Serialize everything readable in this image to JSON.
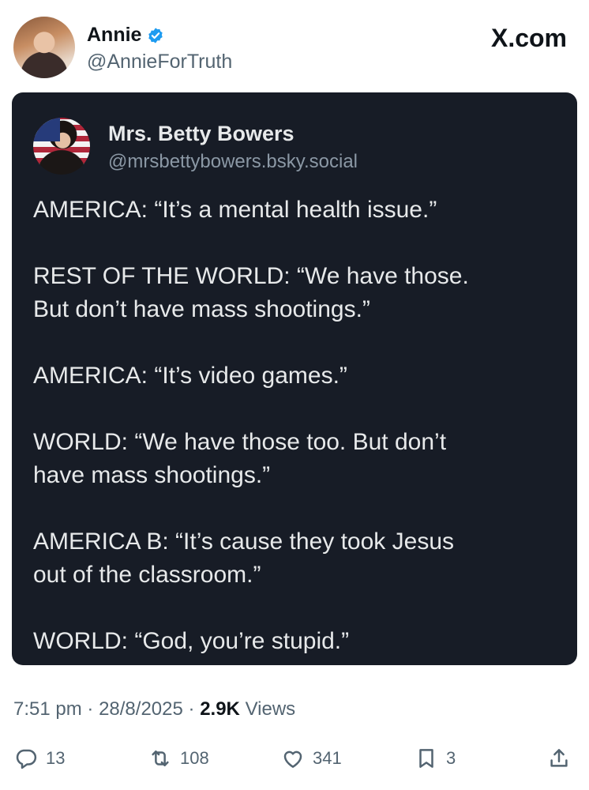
{
  "author": {
    "name": "Annie",
    "handle": "@AnnieForTruth",
    "verified_color": "#1d9bf0"
  },
  "brand": "X.com",
  "quoted_post": {
    "name": "Mrs. Betty Bowers",
    "handle": "@mrsbettybowers.bsky.social",
    "paragraphs": [
      "AMERICA: “It’s a mental health issue.”",
      "REST OF THE WORLD: “We have those.\nBut don’t have mass shootings.”",
      "AMERICA: “It’s video games.”",
      "WORLD: “We have those too. But don’t\nhave mass shootings.”",
      "AMERICA B: “It’s cause they took Jesus\nout of the classroom.”",
      "WORLD: “God, you’re stupid.”"
    ]
  },
  "meta": {
    "time": "7:51 pm",
    "date": "28/8/2025",
    "views_count": "2.9K",
    "views_label": "Views"
  },
  "actions": {
    "replies": "13",
    "reposts": "108",
    "likes": "341",
    "bookmarks": "3"
  },
  "icons": [
    "verified-badge-icon",
    "reply-icon",
    "repost-icon",
    "like-icon",
    "bookmark-icon",
    "share-icon"
  ]
}
